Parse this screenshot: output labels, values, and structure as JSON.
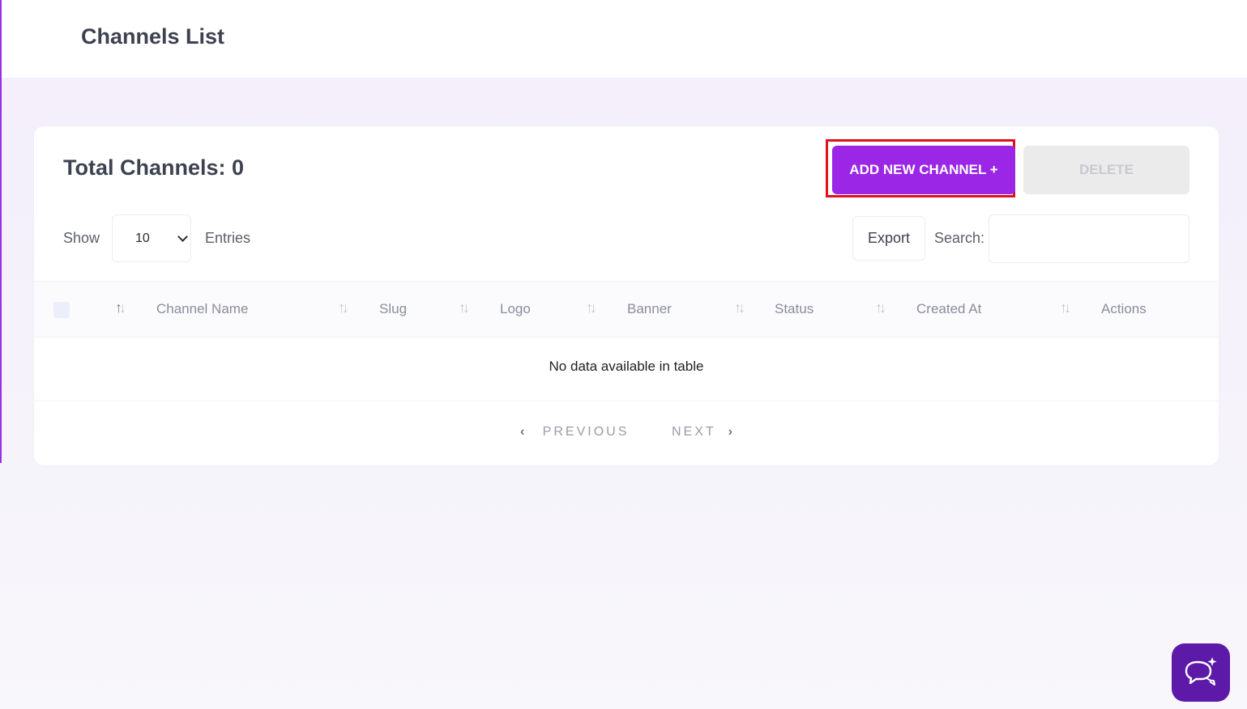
{
  "header": {
    "title": "Channels List"
  },
  "card": {
    "total_label": "Total Channels: 0",
    "add_button": "ADD NEW CHANNEL +",
    "delete_button": "DELETE",
    "show_label": "Show",
    "entries_value": "10",
    "entries_label": "Entries",
    "export_button": "Export",
    "search_label": "Search:",
    "search_value": ""
  },
  "table": {
    "columns": [
      "Channel Name",
      "Slug",
      "Logo",
      "Banner",
      "Status",
      "Created At",
      "Actions"
    ],
    "empty_message": "No data available in table"
  },
  "pagination": {
    "previous": "PREVIOUS",
    "next": "NEXT"
  },
  "colors": {
    "accent": "#9b26e5",
    "highlight_border": "#e0111b",
    "chat_button": "#5d1aa8"
  },
  "icons": {
    "sort": "sort-arrows-icon",
    "prev": "chevron-left-icon",
    "next": "chevron-right-icon",
    "chat": "chat-sparkle-icon",
    "select": "chevron-down-icon"
  }
}
